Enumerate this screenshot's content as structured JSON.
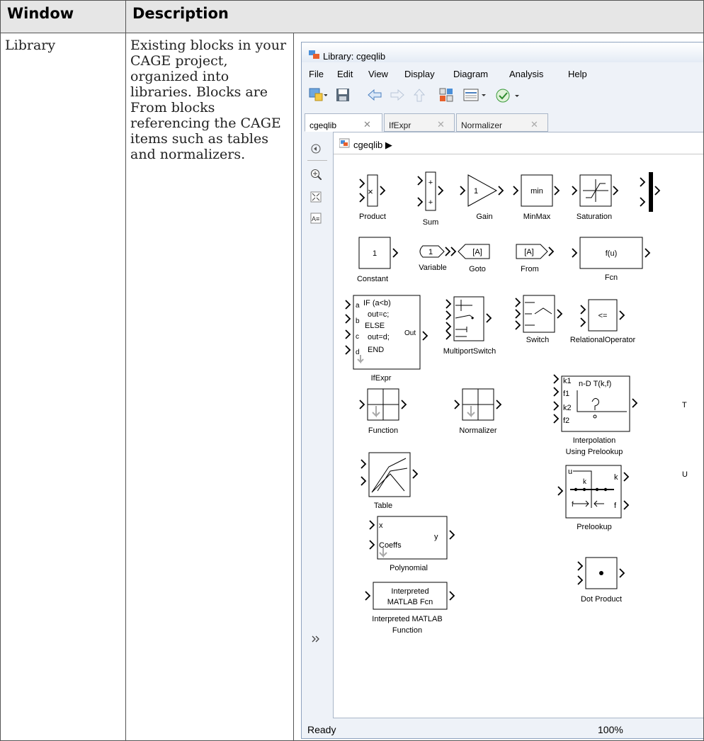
{
  "table": {
    "header_window": "Window",
    "header_description": "Description",
    "row_window": "Library",
    "row_description": "Existing blocks in your CAGE project, organized into libraries. Blocks are From blocks referencing the CAGE items such as tables and normalizers."
  },
  "window": {
    "title": "Library: cgeqlib",
    "menu": [
      "File",
      "Edit",
      "View",
      "Display",
      "Diagram",
      "Analysis",
      "Help"
    ],
    "tabs": [
      "cgeqlib",
      "IfExpr",
      "Normalizer"
    ],
    "breadcrumb": "cgeqlib",
    "status": "Ready",
    "zoom": "100%"
  },
  "blocks": {
    "product": "Product",
    "sum": "Sum",
    "gain": "Gain",
    "gain_value": "1",
    "minmax": "MinMax",
    "minmax_text": "min",
    "saturation": "Saturation",
    "constant": "Constant",
    "constant_value": "1",
    "variable": "Variable",
    "variable_value": "1",
    "goto": "Goto",
    "goto_tag": "[A]",
    "from": "From",
    "from_tag": "[A]",
    "fcn": "Fcn",
    "fcn_text": "f(u)",
    "ifexpr": "IfExpr",
    "ifexpr_lines": [
      "IF (a<b)",
      "out=c;",
      "ELSE",
      "out=d;",
      "END"
    ],
    "ifexpr_ports": [
      "a",
      "b",
      "c",
      "d"
    ],
    "ifexpr_out": "Out",
    "multiport": "MultiportSwitch",
    "switch": "Switch",
    "relop": "RelationalOperator",
    "relop_text": "<=",
    "function": "Function",
    "normalizer": "Normalizer",
    "interp_line1": "Interpolation",
    "interp_line2": "Using Prelookup",
    "interp_text": "n-D T(k,f)",
    "interp_ports": [
      "k1",
      "f1",
      "k2",
      "f2"
    ],
    "table": "Table",
    "prelookup": "Prelookup",
    "prelookup_ports": [
      "u",
      "k",
      "k",
      "f",
      "f"
    ],
    "polynomial": "Polynomial",
    "poly_x": "x",
    "poly_y": "y",
    "poly_coeffs": "Coeffs",
    "interpreted_box1": "Interpreted",
    "interpreted_box2": "MATLAB Fcn",
    "interpreted_label1": "Interpreted MATLAB",
    "interpreted_label2": "Function",
    "dot_product": "Dot Product",
    "edge_t": "T",
    "edge_u": "U"
  }
}
